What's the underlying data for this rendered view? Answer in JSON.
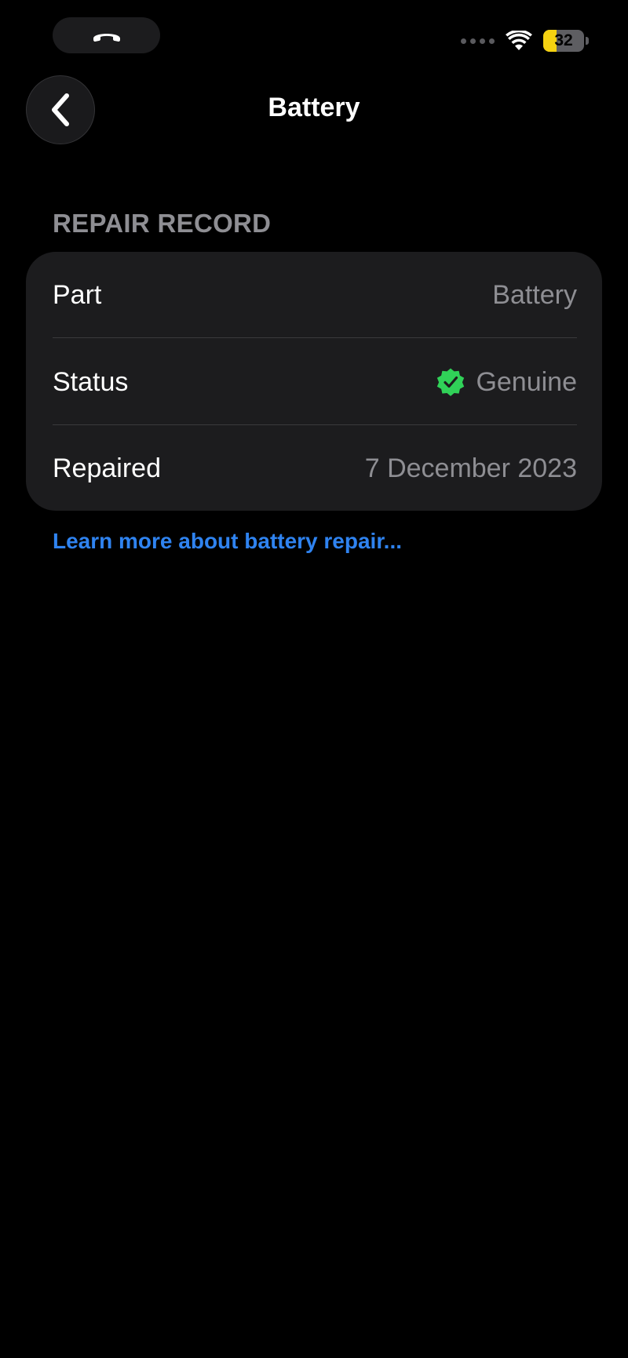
{
  "status_bar": {
    "call_icon": "phone-hangup-icon",
    "signal_icon": "signal-dots-icon",
    "wifi_icon": "wifi-icon",
    "battery_percent": "32",
    "battery_level": 0.32,
    "battery_color": "#f5d211"
  },
  "nav": {
    "back_icon": "chevron-left-icon",
    "title": "Battery"
  },
  "repair_record": {
    "header": "REPAIR RECORD",
    "rows": [
      {
        "label": "Part",
        "value": "Battery"
      },
      {
        "label": "Status",
        "value": "Genuine",
        "icon": "verified-badge-icon",
        "icon_color": "#30d158"
      },
      {
        "label": "Repaired",
        "value": "7 December 2023"
      }
    ]
  },
  "link": {
    "label": "Learn more about battery repair...",
    "color": "#2f83f0"
  }
}
